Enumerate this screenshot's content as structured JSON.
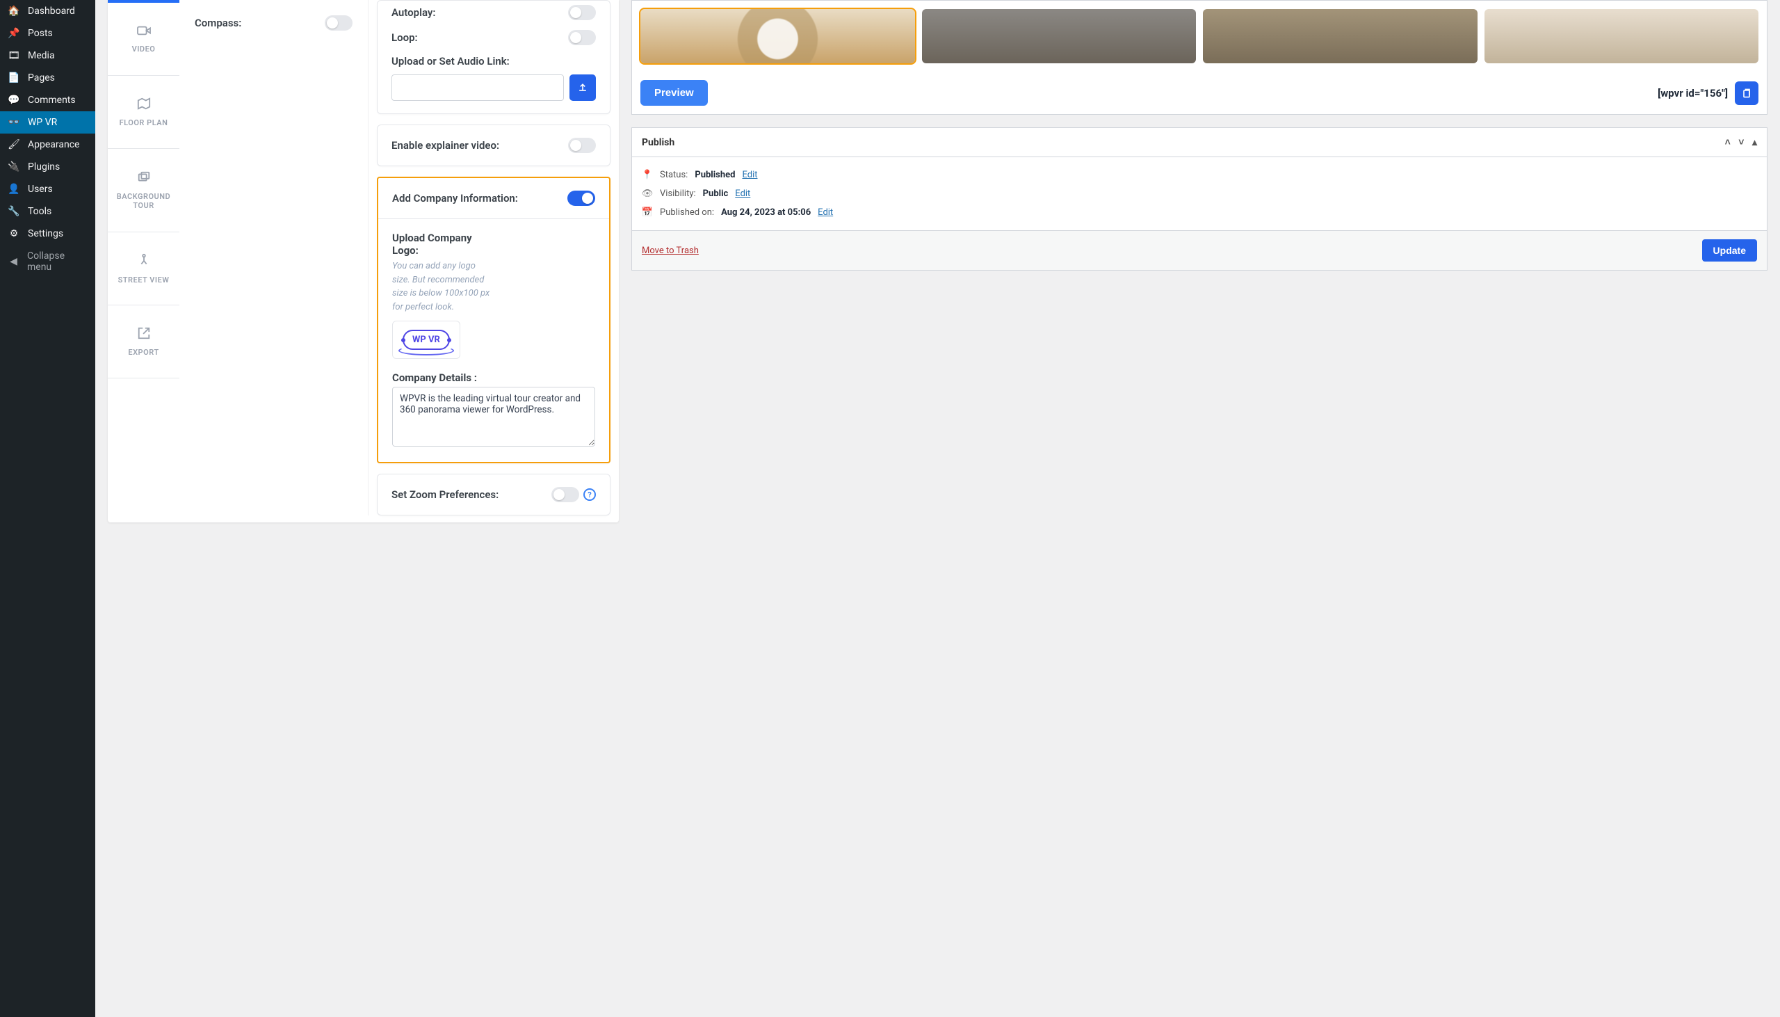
{
  "adminMenu": {
    "dashboard": "Dashboard",
    "posts": "Posts",
    "media": "Media",
    "pages": "Pages",
    "comments": "Comments",
    "wpvr": "WP VR",
    "appearance": "Appearance",
    "plugins": "Plugins",
    "users": "Users",
    "tools": "Tools",
    "settings": "Settings",
    "collapse": "Collapse menu"
  },
  "vtabs": {
    "video": "VIDEO",
    "floorplan": "FLOOR PLAN",
    "bgtour": "BACKGROUND TOUR",
    "streetview": "STREET VIEW",
    "export": "EXPORT"
  },
  "compass": {
    "label": "Compass:"
  },
  "audio": {
    "autoplay": "Autoplay:",
    "loop": "Loop:",
    "upload": "Upload or Set Audio Link:"
  },
  "explainer": {
    "label": "Enable explainer video:"
  },
  "company": {
    "title": "Add Company Information:",
    "uploadLogo": "Upload Company Logo:",
    "hint": "You can add any logo size. But recommended size is below 100x100 px for perfect look.",
    "badge": "WP VR",
    "detailsLabel": "Company Details :",
    "detailsText": "WPVR is the leading virtual tour creator and 360 panorama viewer for WordPress."
  },
  "zoom": {
    "label": "Set Zoom Preferences:"
  },
  "preview": {
    "btn": "Preview",
    "shortcode": "[wpvr id=\"156\"]"
  },
  "publish": {
    "title": "Publish",
    "statusLabel": "Status:",
    "statusVal": "Published",
    "visibilityLabel": "Visibility:",
    "visibilityVal": "Public",
    "publishedOnLabel": "Published on:",
    "publishedOnVal": "Aug 24, 2023 at 05:06",
    "edit": "Edit",
    "trash": "Move to Trash",
    "update": "Update"
  }
}
